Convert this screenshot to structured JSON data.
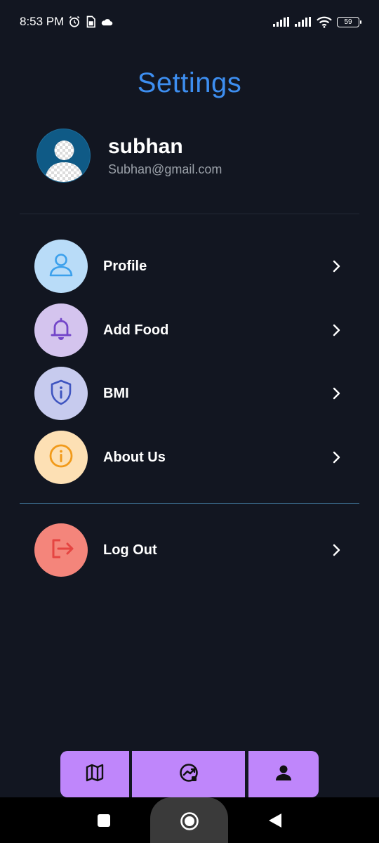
{
  "status_bar": {
    "time": "8:53 PM",
    "battery": "59",
    "icons": [
      "alarm-icon",
      "sim-card-icon",
      "cloud-icon",
      "signal-icon",
      "signal-icon",
      "wifi-icon",
      "battery-icon"
    ]
  },
  "page": {
    "title": "Settings"
  },
  "user": {
    "name": "subhan",
    "email": "Subhan@gmail.com"
  },
  "menu": {
    "items": [
      {
        "label": "Profile",
        "icon": "user-icon",
        "bg": "#b9dcf8",
        "fg": "#3ba0ec"
      },
      {
        "label": "Add Food",
        "icon": "bell-icon",
        "bg": "#d4c4ee",
        "fg": "#7346c9"
      },
      {
        "label": "BMI",
        "icon": "shield-info-icon",
        "bg": "#c7cbee",
        "fg": "#3f55c0"
      },
      {
        "label": "About Us",
        "icon": "info-icon",
        "bg": "#fde0b4",
        "fg": "#f19a1a"
      }
    ],
    "logout": {
      "label": "Log Out",
      "icon": "logout-icon",
      "bg": "#f4857b",
      "fg": "#e54542"
    }
  },
  "tabs": [
    {
      "icon": "map-icon"
    },
    {
      "icon": "trend-icon"
    },
    {
      "icon": "person-icon"
    }
  ],
  "colors": {
    "background": "#121621",
    "title": "#3d8ef0",
    "tab_bar": "#bf86fb"
  }
}
